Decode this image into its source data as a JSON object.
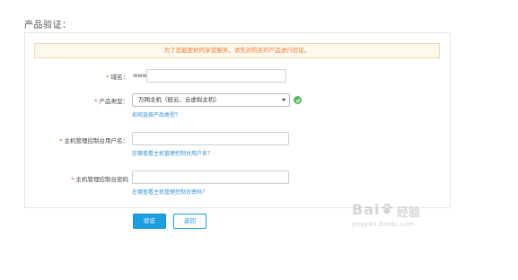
{
  "page": {
    "title": "产品验证："
  },
  "notice": {
    "text": "为了您能更好的享受服务，请先对购买的产品进行验证。"
  },
  "form": {
    "domain": {
      "required_mark": "*",
      "label": "域名：",
      "prefix": "www.",
      "value": ""
    },
    "product_type": {
      "required_mark": "*",
      "label": "产品类型：",
      "selected": "万网主机（经云、云虚拟主机）",
      "help": "如何选择产品类型？"
    },
    "panel_username": {
      "required_mark": "*",
      "label": "主机管理控制台用户名：",
      "value": "",
      "help": "在哪查看主机管理控制台用户名？"
    },
    "panel_password": {
      "required_mark": "*",
      "label": "主机管理控制台密码",
      "value": "",
      "help": "在哪查看主机管理控制台密码？"
    }
  },
  "buttons": {
    "verify": "验证",
    "back": "返回"
  },
  "watermark": {
    "brand": "Bai",
    "suffix": "经验",
    "url": "jingyan.baidu.com"
  },
  "colors": {
    "primary": "#1e9ee0",
    "link": "#2e8ed3",
    "required": "#e84c3d",
    "notice_text": "#f07a2f",
    "success": "#5cb85c"
  }
}
